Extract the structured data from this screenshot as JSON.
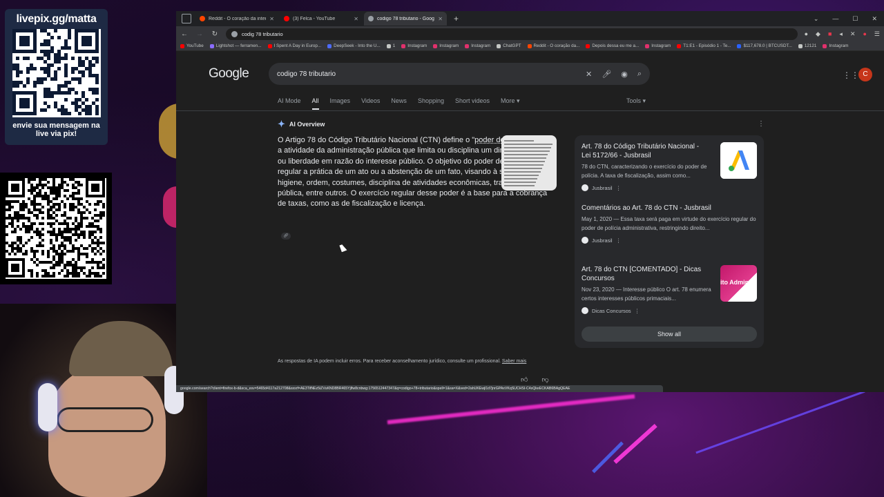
{
  "overlay": {
    "pix_title": "livepix.gg/matta",
    "pix_caption": "envie sua mensagem na live via pix!"
  },
  "browser": {
    "tabs": [
      {
        "label": "Reddit - O coração da internet",
        "color": "#ff4500",
        "active": false
      },
      {
        "label": "(3) Felca - YouTube",
        "color": "#ff0000",
        "active": false
      },
      {
        "label": "codigo 78 tributario - Google S...",
        "color": "#9aa0a6",
        "active": true
      }
    ],
    "address": "codig 78 tributario",
    "bookmarks": [
      {
        "label": "YouTube",
        "color": "#ff0000"
      },
      {
        "label": "Lightshot — ferramen...",
        "color": "#8a6cff"
      },
      {
        "label": "I Spent A Day in Europ...",
        "color": "#ff0000"
      },
      {
        "label": "DeepSeek - Into the U...",
        "color": "#4d6bfe"
      },
      {
        "label": "1",
        "color": "#c4c7c5"
      },
      {
        "label": "Instagram",
        "color": "#e1306c"
      },
      {
        "label": "Instagram",
        "color": "#e1306c"
      },
      {
        "label": "Instagram",
        "color": "#e1306c"
      },
      {
        "label": "ChatGPT",
        "color": "#c4c7c5"
      },
      {
        "label": "Reddit - O coração da...",
        "color": "#ff4500"
      },
      {
        "label": "Depois dessa eu me a...",
        "color": "#ff0000"
      },
      {
        "label": "Instagram",
        "color": "#e1306c"
      },
      {
        "label": "T1:E1 - Episódio 1 - Te...",
        "color": "#ff0000"
      },
      {
        "label": "$117,678.0 | BTCUSDT...",
        "color": "#2962ff"
      },
      {
        "label": "12121",
        "color": "#c4c7c5"
      },
      {
        "label": "Instagram",
        "color": "#e1306c"
      }
    ],
    "status_url": "google.com/search?client=firefox-b-d&sca_esv=5465d4117a212708&sxsrf=AE3TifNEz5iZVuKND8BR465Yjlfw8cnbwg:1756512447347&q=codigo+78+tributario&spell=1&sa=X&ved=2ahUKEwjl1d7jnrGPAxVKqSUCHSI-C4sQkeECKAB6BAgQEAE"
  },
  "google": {
    "logo": "Google",
    "query": "codigo 78 tributario",
    "avatar_letter": "C",
    "filters": [
      "AI Mode",
      "All",
      "Images",
      "Videos",
      "News",
      "Shopping",
      "Short videos",
      "More ▾"
    ],
    "active_filter": "All",
    "tools": "Tools ▾",
    "aio_heading": "AI Overview",
    "aio_before": "O Artigo 78 do Código Tributário Nacional (CTN) define o \"",
    "aio_link": "poder de polícia",
    "aio_after": "\" como a atividade da administração pública que limita ou disciplina um direito, interesse ou liberdade em razão do interesse público. O objetivo do poder de polícia é regular a prática de um ato ou a abstenção de um fato, visando à segurança, higiene, ordem, costumes, disciplina de atividades econômicas, tranquilidade pública, entre outros. O exercício regular desse poder é a base para a cobrança de taxas, como as de fiscalização e licença.",
    "sources": [
      {
        "title": "Art. 78 do Código Tributário Nacional - Lei 5172/66 - Jusbrasil",
        "date": "",
        "snippet": "78 do CTN, caracterizando o exercício do poder de polícia. A taxa de fiscalização, assim como...",
        "site": "Jusbrasil",
        "image": "jusbrasil-logo"
      },
      {
        "title": "Comentários ao Art. 78 do CTN - Jusbrasil",
        "date": "May 1, 2020",
        "snippet": "May 1, 2020 — Essa taxa será paga em virtude do exercício regular do poder de polícia administrativa, restringindo direito...",
        "site": "Jusbrasil",
        "image": ""
      },
      {
        "title": "Art. 78 do CTN [COMENTADO] - Dicas Concursos",
        "date": "Nov 23, 2020",
        "snippet": "Nov 23, 2020 — Interesse público O art. 78 enumera certos interesses públicos primaciais...",
        "site": "Dicas Concursos",
        "image_text": "ito Adminis"
      }
    ],
    "show_all": "Show all",
    "disclaimer": "As respostas de IA podem incluir erros. Para receber aconselhamento jurídico, consulte um profissional.",
    "learn_more": "Saber mais"
  }
}
